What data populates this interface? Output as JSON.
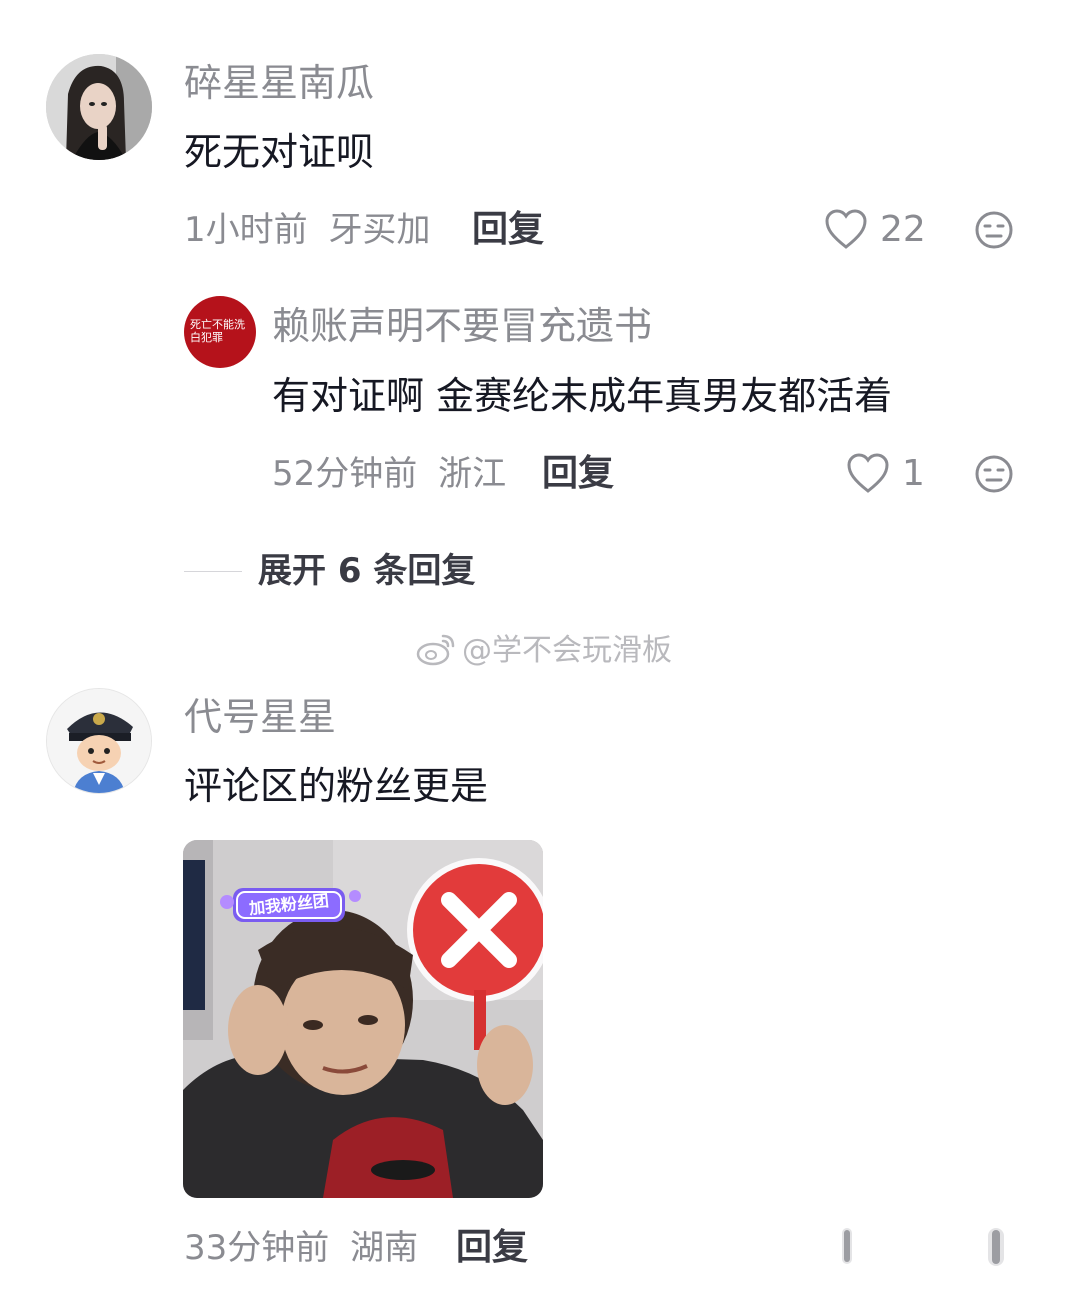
{
  "comments": [
    {
      "username": "碎星星南瓜",
      "text": "死无对证呗",
      "time": "1小时前",
      "location": "牙买加",
      "reply_label": "回复",
      "likes": "22",
      "replies": [
        {
          "username": "赖账声明不要冒充遗书",
          "avatar_text": "死亡不能洗白犯罪",
          "text": "有对证啊 金赛纶未成年真男友都活着",
          "time": "52分钟前",
          "location": "浙江",
          "reply_label": "回复",
          "likes": "1"
        }
      ],
      "expand_label": "展开 6 条回复"
    },
    {
      "username": "代号星星",
      "text": "评论区的粉丝更是",
      "image_badge": "加我粉丝团",
      "time": "33分钟前",
      "location": "湖南",
      "reply_label": "回复"
    }
  ],
  "watermark": "@学不会玩滑板",
  "icons": {
    "like": "heart-outline-icon",
    "dislike": "meh-face-icon",
    "weibo": "weibo-logo-icon"
  },
  "colors": {
    "username": "#8a8b91",
    "text": "#161823",
    "reply_avatar_bg": "#b5121b",
    "cross_sign": "#e23b3b"
  }
}
